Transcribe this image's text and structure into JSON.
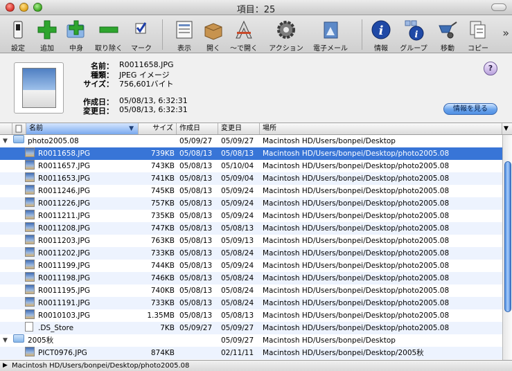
{
  "window": {
    "title": "項目：25"
  },
  "toolbar": {
    "items": [
      {
        "label": "設定"
      },
      {
        "label": "追加"
      },
      {
        "label": "中身"
      },
      {
        "label": "取り除く"
      },
      {
        "label": "マーク"
      },
      {
        "label": "表示"
      },
      {
        "label": "開く"
      },
      {
        "label": "〜で開く"
      },
      {
        "label": "アクション"
      },
      {
        "label": "電子メール"
      },
      {
        "label": "情報"
      },
      {
        "label": "グループ"
      },
      {
        "label": "移動"
      },
      {
        "label": "コピー"
      }
    ],
    "overflow": "»"
  },
  "info": {
    "name_label": "名前：",
    "name": "R0011658.JPG",
    "kind_label": "種類：",
    "kind": "JPEG イメージ",
    "size_label": "サイズ：",
    "size": "756,601バイト",
    "created_label": "作成日：",
    "created": "05/08/13, 6:32:31",
    "modified_label": "変更日：",
    "modified": "05/08/13, 6:32:31",
    "help": "?",
    "more_info_button": "情報を見る"
  },
  "columns": {
    "name": "名前",
    "size": "サイズ",
    "created": "作成日",
    "modified": "変更日",
    "location": "場所"
  },
  "rows": [
    {
      "type": "folder",
      "name": "photo2005.08",
      "size": "",
      "created": "05/09/27",
      "modified": "05/09/27",
      "location": "Macintosh HD/Users/bonpei/Desktop"
    },
    {
      "type": "jpg",
      "name": "R0011658.JPG",
      "size": "739KB",
      "created": "05/08/13",
      "modified": "05/08/13",
      "location": "Macintosh HD/Users/bonpei/Desktop/photo2005.08"
    },
    {
      "type": "jpg",
      "name": "R0011657.JPG",
      "size": "743KB",
      "created": "05/08/13",
      "modified": "05/10/04",
      "location": "Macintosh HD/Users/bonpei/Desktop/photo2005.08"
    },
    {
      "type": "jpg",
      "name": "R0011653.JPG",
      "size": "741KB",
      "created": "05/08/13",
      "modified": "05/09/04",
      "location": "Macintosh HD/Users/bonpei/Desktop/photo2005.08"
    },
    {
      "type": "jpg",
      "name": "R0011246.JPG",
      "size": "745KB",
      "created": "05/08/13",
      "modified": "05/09/24",
      "location": "Macintosh HD/Users/bonpei/Desktop/photo2005.08"
    },
    {
      "type": "jpg",
      "name": "R0011226.JPG",
      "size": "757KB",
      "created": "05/08/13",
      "modified": "05/09/24",
      "location": "Macintosh HD/Users/bonpei/Desktop/photo2005.08"
    },
    {
      "type": "jpg",
      "name": "R0011211.JPG",
      "size": "735KB",
      "created": "05/08/13",
      "modified": "05/09/24",
      "location": "Macintosh HD/Users/bonpei/Desktop/photo2005.08"
    },
    {
      "type": "jpg",
      "name": "R0011208.JPG",
      "size": "747KB",
      "created": "05/08/13",
      "modified": "05/08/13",
      "location": "Macintosh HD/Users/bonpei/Desktop/photo2005.08"
    },
    {
      "type": "jpg",
      "name": "R0011203.JPG",
      "size": "763KB",
      "created": "05/08/13",
      "modified": "05/09/13",
      "location": "Macintosh HD/Users/bonpei/Desktop/photo2005.08"
    },
    {
      "type": "jpg",
      "name": "R0011202.JPG",
      "size": "733KB",
      "created": "05/08/13",
      "modified": "05/08/24",
      "location": "Macintosh HD/Users/bonpei/Desktop/photo2005.08"
    },
    {
      "type": "jpg",
      "name": "R0011199.JPG",
      "size": "744KB",
      "created": "05/08/13",
      "modified": "05/09/24",
      "location": "Macintosh HD/Users/bonpei/Desktop/photo2005.08"
    },
    {
      "type": "jpg",
      "name": "R0011198.JPG",
      "size": "746KB",
      "created": "05/08/13",
      "modified": "05/08/24",
      "location": "Macintosh HD/Users/bonpei/Desktop/photo2005.08"
    },
    {
      "type": "jpg",
      "name": "R0011195.JPG",
      "size": "740KB",
      "created": "05/08/13",
      "modified": "05/08/24",
      "location": "Macintosh HD/Users/bonpei/Desktop/photo2005.08"
    },
    {
      "type": "jpg",
      "name": "R0011191.JPG",
      "size": "733KB",
      "created": "05/08/13",
      "modified": "05/08/24",
      "location": "Macintosh HD/Users/bonpei/Desktop/photo2005.08"
    },
    {
      "type": "jpg",
      "name": "R0010103.JPG",
      "size": "1.35MB",
      "created": "05/08/13",
      "modified": "05/08/13",
      "location": "Macintosh HD/Users/bonpei/Desktop/photo2005.08"
    },
    {
      "type": "doc",
      "name": ".DS_Store",
      "size": "7KB",
      "created": "05/09/27",
      "modified": "05/09/27",
      "location": "Macintosh HD/Users/bonpei/Desktop/photo2005.08"
    },
    {
      "type": "folder",
      "name": "2005秋",
      "size": "",
      "created": "",
      "modified": "05/09/27",
      "location": "Macintosh HD/Users/bonpei/Desktop"
    },
    {
      "type": "jpg",
      "name": "PICT0976.JPG",
      "size": "874KB",
      "created": "",
      "modified": "02/11/11",
      "location": "Macintosh HD/Users/bonpei/Desktop/2005秋"
    }
  ],
  "status": {
    "path": "Macintosh HD/Users/bonpei/Desktop/photo2005.08"
  },
  "colors": {
    "selection": "#3875d7",
    "alt_row": "#edf3fe"
  }
}
